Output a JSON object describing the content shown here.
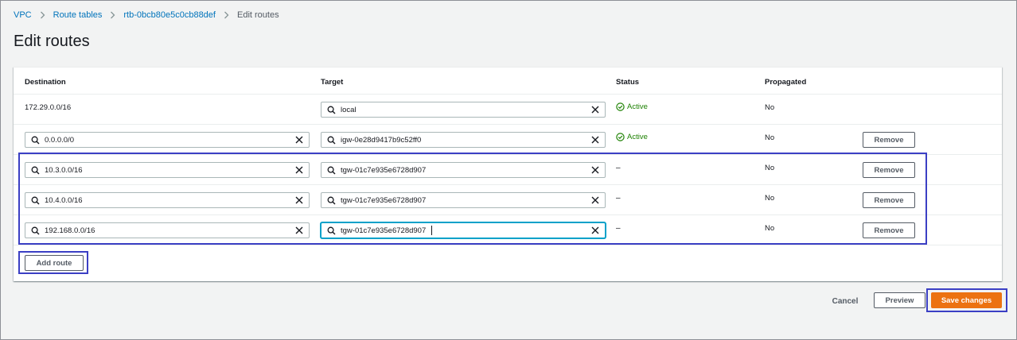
{
  "breadcrumb": {
    "items": [
      "VPC",
      "Route tables",
      "rtb-0bcb80e5c0cb88def"
    ],
    "current": "Edit routes"
  },
  "page": {
    "title": "Edit routes"
  },
  "table": {
    "headers": {
      "destination": "Destination",
      "target": "Target",
      "status": "Status",
      "propagated": "Propagated"
    },
    "rows": [
      {
        "destination": "172.29.0.0/16",
        "target": "local",
        "status": "Active",
        "propagated": "No"
      },
      {
        "destination": "0.0.0.0/0",
        "target": "igw-0e28d9417b9c52ff0",
        "status": "Active",
        "propagated": "No",
        "remove": "Remove"
      },
      {
        "destination": "10.3.0.0/16",
        "target": "tgw-01c7e935e6728d907",
        "status": "–",
        "propagated": "No",
        "remove": "Remove"
      },
      {
        "destination": "10.4.0.0/16",
        "target": "tgw-01c7e935e6728d907",
        "status": "–",
        "propagated": "No",
        "remove": "Remove"
      },
      {
        "destination": "192.168.0.0/16",
        "target": "tgw-01c7e935e6728d907",
        "status": "–",
        "propagated": "No",
        "remove": "Remove"
      }
    ],
    "add_route": "Add route"
  },
  "footer": {
    "cancel": "Cancel",
    "preview": "Preview",
    "save": "Save changes"
  },
  "colors": {
    "link": "#0073bb",
    "active": "#1d8102",
    "primary": "#ec7211",
    "highlight": "#3b3fc4",
    "focus": "#00a1c9"
  },
  "icons": {
    "search": "search-icon",
    "clear": "clear-icon",
    "status_ok": "check-circle-icon",
    "breadcrumb_separator": "chevron-right-icon"
  }
}
